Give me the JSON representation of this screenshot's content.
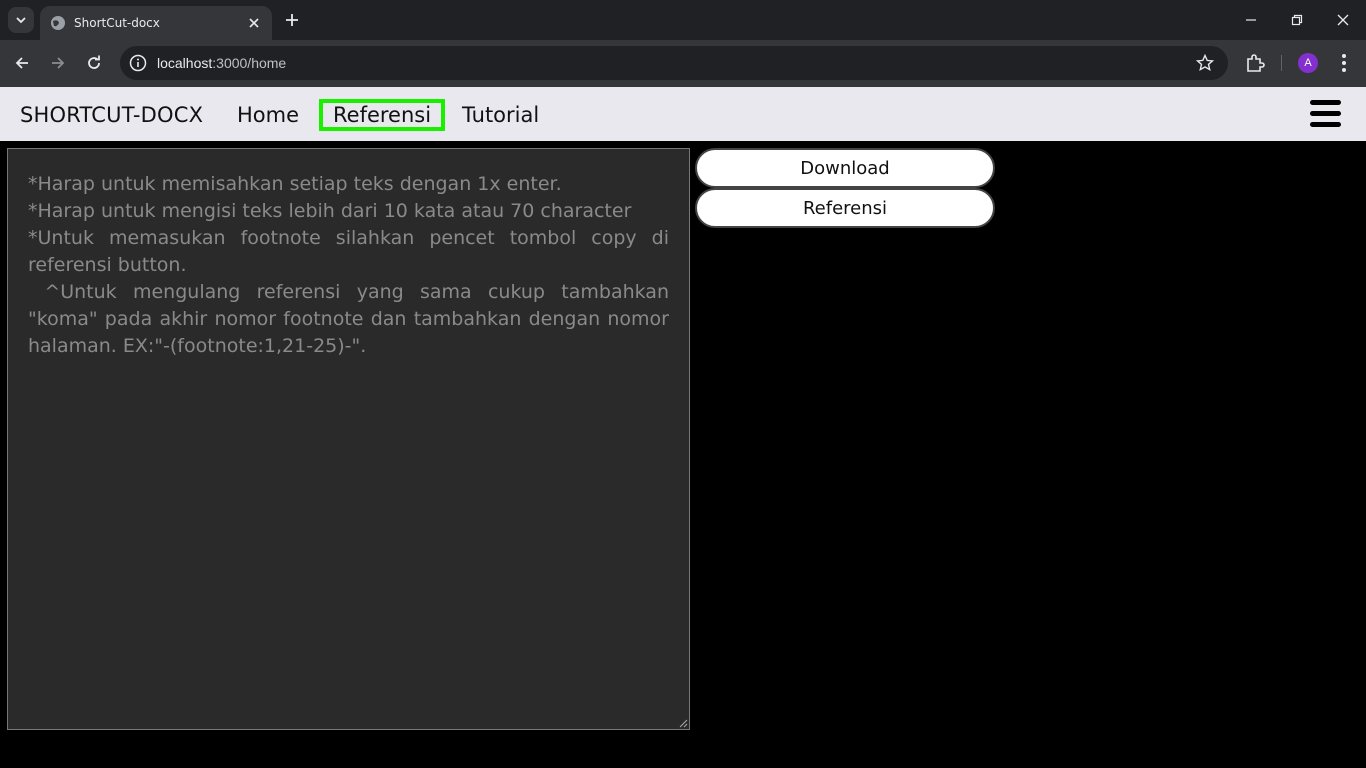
{
  "browser": {
    "tab_title": "ShortCut-docx",
    "url_host": "localhost",
    "url_path": ":3000/home",
    "avatar_letter": "A"
  },
  "navbar": {
    "brand": "SHORTCUT-DOCX",
    "links": [
      {
        "label": "Home"
      },
      {
        "label": "Referensi"
      },
      {
        "label": "Tutorial"
      }
    ],
    "active_highlight_color": "#19f000"
  },
  "editor": {
    "placeholder_lines": [
      "*Harap untuk memisahkan setiap teks dengan 1x enter.",
      "*Harap untuk mengisi teks lebih dari 10 kata atau 70 character",
      "*Untuk memasukan footnote silahkan pencet tombol copy di referensi button.",
      " ^Untuk mengulang referensi yang sama cukup tambahkan \"koma\" pada akhir nomor footnote dan tambahkan dengan nomor halaman. EX:\"-(footnote:1,21-25)-\"."
    ]
  },
  "actions": {
    "download_label": "Download",
    "referensi_label": "Referensi"
  }
}
